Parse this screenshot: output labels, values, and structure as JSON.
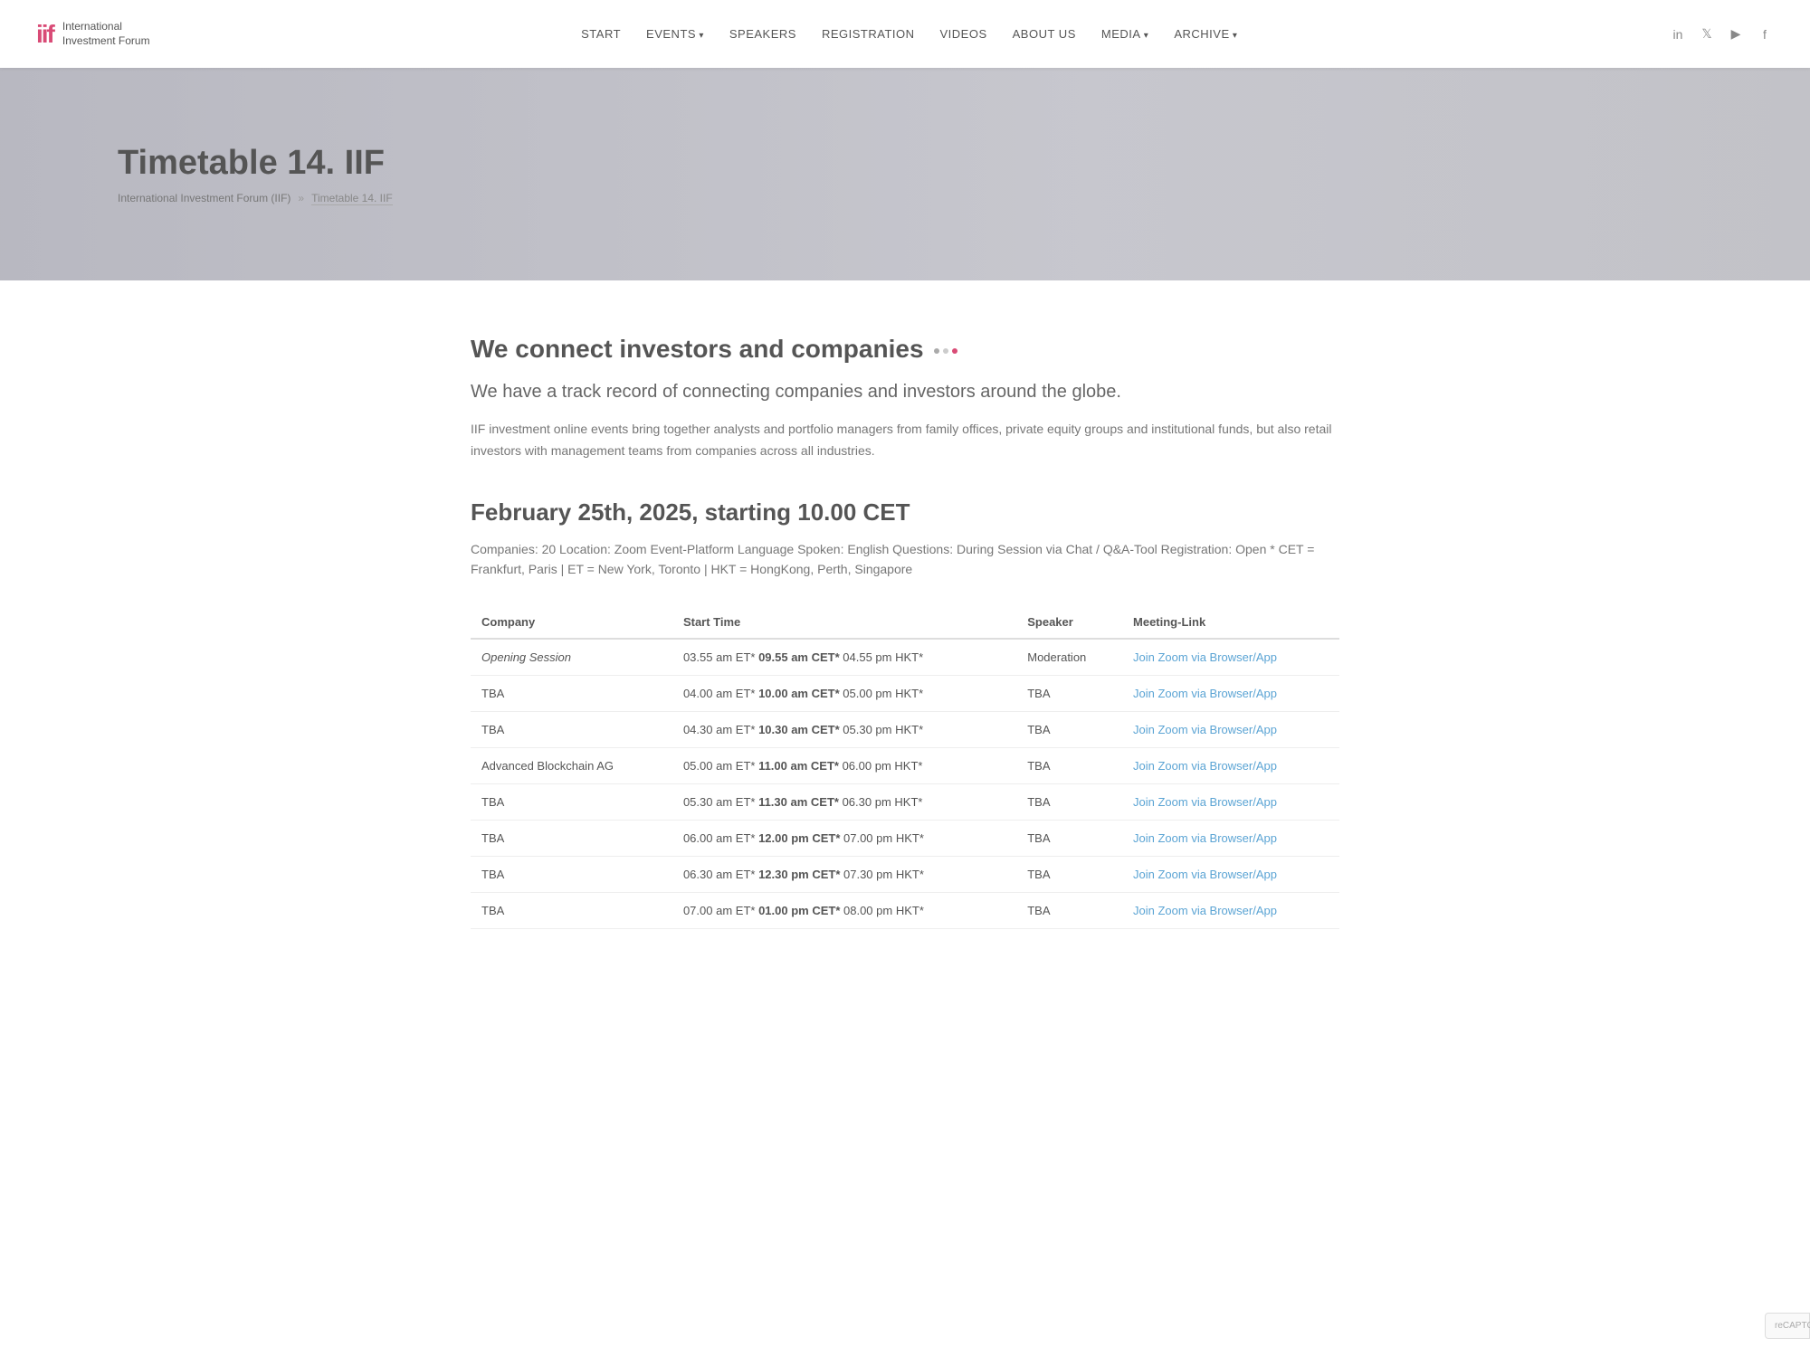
{
  "nav": {
    "logo_mark": "iif",
    "logo_line1": "International",
    "logo_line2": "Investment Forum",
    "links": [
      {
        "label": "START",
        "has_arrow": false,
        "name": "nav-start"
      },
      {
        "label": "EVENTS",
        "has_arrow": true,
        "name": "nav-events"
      },
      {
        "label": "SPEAKERS",
        "has_arrow": false,
        "name": "nav-speakers"
      },
      {
        "label": "REGISTRATION",
        "has_arrow": false,
        "name": "nav-registration"
      },
      {
        "label": "VIDEOS",
        "has_arrow": false,
        "name": "nav-videos"
      },
      {
        "label": "ABOUT US",
        "has_arrow": false,
        "name": "nav-about-us"
      },
      {
        "label": "MEDIA",
        "has_arrow": true,
        "name": "nav-media"
      },
      {
        "label": "ARCHIVE",
        "has_arrow": true,
        "name": "nav-archive"
      }
    ],
    "socials": [
      "in",
      "𝕏",
      "▶",
      "f"
    ]
  },
  "hero": {
    "title": "Timetable 14. IIF",
    "breadcrumb_link": "International Investment Forum (IIF)",
    "breadcrumb_sep": "»",
    "breadcrumb_current": "Timetable 14. IIF"
  },
  "content": {
    "heading1": "We connect investors and companies",
    "subheading": "We have a track record of connecting companies and investors around the globe.",
    "body": "IIF investment online events bring together analysts and portfolio managers from family offices, private equity groups and institutional funds, but also retail investors with management teams from companies across all industries.",
    "event_heading": "February 25th, 2025, starting 10.00 CET",
    "event_meta": "Companies: 20 Location: Zoom Event-Platform Language Spoken: English Questions: During Session via Chat / Q&A-Tool Registration: Open * CET = Frankfurt, Paris | ET = New York, Toronto | HKT = HongKong, Perth, Singapore"
  },
  "table": {
    "headers": [
      "Company",
      "Start Time",
      "Speaker",
      "Meeting-Link"
    ],
    "rows": [
      {
        "company": "Opening Session",
        "company_italic": true,
        "start_time": "03.55 am ET*",
        "start_time_bold": "09.55 am CET*",
        "start_time_suffix": " 04.55 pm HKT*",
        "speaker": "Moderation",
        "meeting_link": "Join Zoom via Browser/App"
      },
      {
        "company": "TBA",
        "company_italic": false,
        "start_time": "04.00 am ET*",
        "start_time_bold": "10.00 am CET*",
        "start_time_suffix": " 05.00 pm HKT*",
        "speaker": "TBA",
        "meeting_link": "Join Zoom via Browser/App"
      },
      {
        "company": "TBA",
        "company_italic": false,
        "start_time": "04.30 am ET*",
        "start_time_bold": "10.30 am CET*",
        "start_time_suffix": " 05.30 pm HKT*",
        "speaker": "TBA",
        "meeting_link": "Join Zoom via Browser/App"
      },
      {
        "company": "Advanced Blockchain AG",
        "company_italic": false,
        "start_time": "05.00 am ET*",
        "start_time_bold": "11.00 am CET*",
        "start_time_suffix": " 06.00 pm HKT*",
        "speaker": "TBA",
        "meeting_link": "Join Zoom via Browser/App"
      },
      {
        "company": "TBA",
        "company_italic": false,
        "start_time": "05.30 am ET*",
        "start_time_bold": "11.30 am CET*",
        "start_time_suffix": " 06.30 pm HKT*",
        "speaker": "TBA",
        "meeting_link": "Join Zoom via Browser/App"
      },
      {
        "company": "TBA",
        "company_italic": false,
        "start_time": "06.00 am ET*",
        "start_time_bold": "12.00 pm CET*",
        "start_time_suffix": " 07.00 pm HKT*",
        "speaker": "TBA",
        "meeting_link": "Join Zoom via Browser/App"
      },
      {
        "company": "TBA",
        "company_italic": false,
        "start_time": "06.30 am ET*",
        "start_time_bold": "12.30 pm CET*",
        "start_time_suffix": " 07.30 pm HKT*",
        "speaker": "TBA",
        "meeting_link": "Join Zoom via Browser/App"
      },
      {
        "company": "TBA",
        "company_italic": false,
        "start_time": "07.00 am ET*",
        "start_time_bold": "01.00 pm CET*",
        "start_time_suffix": " 08.00 pm HKT*",
        "speaker": "TBA",
        "meeting_link": "Join Zoom via Browser/App"
      }
    ]
  }
}
